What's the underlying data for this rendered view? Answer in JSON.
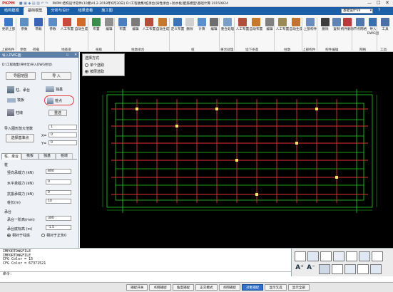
{
  "title": {
    "app": "PKPM 结构设计软件(10版V4.2-2018年6月30日) D:\\工程收集\\桩承台(异性承台+防水板)配筋模型\\基础计算 20150824",
    "version_label": "基础设计V4",
    "logo_text": "PKPM"
  },
  "menu_tabs": [
    {
      "label": "结构建模"
    },
    {
      "label": "基础模型"
    },
    {
      "label": "分析与设计"
    },
    {
      "label": "结果查看"
    },
    {
      "label": "施工图"
    }
  ],
  "ribbon": {
    "buttons": [
      {
        "label": "更新上部",
        "color": "#3b79c9"
      },
      {
        "label": "参数",
        "color": "#5e8fc2"
      },
      {
        "label": "荷载",
        "color": "#3a62b5"
      },
      {
        "label": "参数",
        "color": "#5c8dc4"
      },
      {
        "label": "人工布置",
        "color": "#c94a3d"
      },
      {
        "label": "自动生成",
        "color": "#d16b2a"
      },
      {
        "label": "布置",
        "color": "#3c8e4c"
      },
      {
        "label": "编辑",
        "color": "#8f8f8f"
      },
      {
        "label": "布置",
        "color": "#4c7fbd"
      },
      {
        "label": "编辑",
        "color": "#7a7a7a"
      },
      {
        "label": "人工布置",
        "color": "#b84c3b"
      },
      {
        "label": "自动生成",
        "color": "#c6782d"
      },
      {
        "label": "定义布置",
        "color": "#3d74b9"
      },
      {
        "label": "删除",
        "color": "#d0d0d0"
      },
      {
        "label": "计算",
        "color": "#5a8fcf"
      },
      {
        "label": "编辑",
        "color": "#6e6e6e"
      },
      {
        "label": "重合处理",
        "color": "#7aa0c8"
      },
      {
        "label": "人工布置",
        "color": "#b0503a"
      },
      {
        "label": "自动布置",
        "color": "#c47b2e"
      },
      {
        "label": "编辑",
        "color": "#808080"
      },
      {
        "label": "人工布置",
        "color": "#9c8a56"
      },
      {
        "label": "自动生成",
        "color": "#c17330"
      },
      {
        "label": "上部构件",
        "color": "#6a8cbf"
      },
      {
        "label": "删除",
        "color": "#3c3c3c"
      },
      {
        "label": "复制",
        "color": "#5f83b5"
      },
      {
        "label": "构件删除",
        "color": "#b83a3a"
      },
      {
        "label": "节点网格",
        "color": "#5077b0"
      },
      {
        "label": "导入DWG图",
        "color": "#3a6fb0"
      },
      {
        "label": "工具",
        "color": "#4b6fa6"
      }
    ],
    "groups": [
      {
        "label": "上部构件"
      },
      {
        "label": "参数"
      },
      {
        "label": "荷载"
      },
      {
        "label": "地基梁"
      },
      {
        "label": "筏板"
      },
      {
        "label": "柱墩承台"
      },
      {
        "label": "桩"
      },
      {
        "label": "重合处理"
      },
      {
        "label": "墙下条基"
      },
      {
        "label": "柱墩"
      },
      {
        "label": "上部构件"
      },
      {
        "label": "构件编辑"
      },
      {
        "label": "网格"
      },
      {
        "label": "工具"
      }
    ]
  },
  "panel": {
    "header": "导入DWG图",
    "path": "D:\\工程收集\\导柱位\\导入DWG柱位\\",
    "view_button": "导图范围",
    "import_button": "导 入",
    "items": [
      {
        "label": "柱、承台"
      },
      {
        "label": "独基"
      },
      {
        "label": "筏板"
      },
      {
        "label": "桩点"
      },
      {
        "label": "柱墩"
      }
    ],
    "reselect_button": "重选",
    "scale_label": "导入图形放大倍数",
    "scale_value": "1",
    "base_point_button": "选择基准点",
    "x_label": "X=",
    "x_value": "0",
    "y_label": "Y=",
    "y_value": "0",
    "subtabs": [
      {
        "label": "柱、承台"
      },
      {
        "label": "筏板"
      },
      {
        "label": "独基"
      },
      {
        "label": "桩墩"
      }
    ],
    "section_pile": "桩",
    "fields": [
      {
        "label": "竖向承载力 (kN)",
        "value": "800"
      },
      {
        "label": "水平承载力 (kN)",
        "value": "0"
      },
      {
        "label": "抗拔承载力 (kN)",
        "value": "0"
      },
      {
        "label": "桩长(m)",
        "value": "10"
      }
    ],
    "section_cap": "承台",
    "cap_fields": [
      {
        "label": "承台一阶高(mm)",
        "value": "300"
      },
      {
        "label": "承台底标高 (m)",
        "value": "-1.5"
      }
    ],
    "radio_a": "相对于柱底",
    "radio_b": "相对于正负0"
  },
  "select_box": {
    "title": "选择方式",
    "opt1": "单个选取",
    "opt2": "按层选取"
  },
  "command": {
    "lines": [
      "IMPORTDWGFILE",
      "IMPORTDWGFILE",
      "CFG Color = 15",
      "CFG Color = 67371521"
    ],
    "prompt": "命令："
  },
  "status": [
    {
      "label": "捕捉开关"
    },
    {
      "label": "点网捕捉"
    },
    {
      "label": "角度捕捉"
    },
    {
      "label": "正交模式"
    },
    {
      "label": "点网捕捉"
    },
    {
      "label": "对象捕捉"
    },
    {
      "label": "显示叉选"
    },
    {
      "label": "显示全部"
    }
  ],
  "colors": {
    "accent": "#1a5fa8",
    "grid_red": "#e03030",
    "grid_green": "#22d422",
    "highlight": "#e53935"
  }
}
